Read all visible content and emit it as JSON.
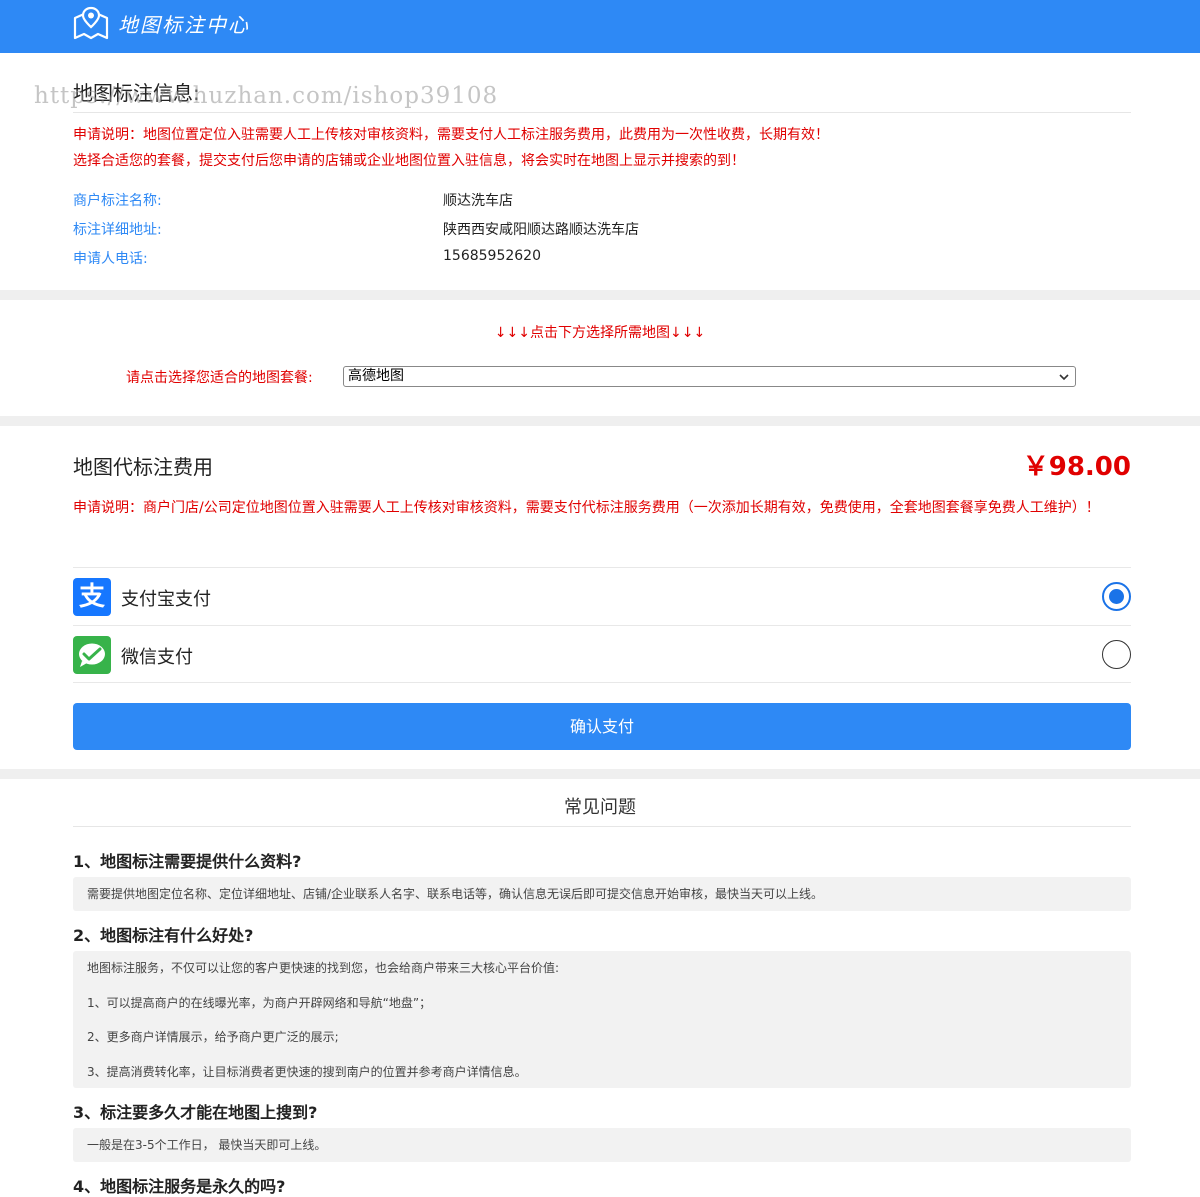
{
  "header": {
    "logo_text": "地图标注中心"
  },
  "info": {
    "title": "地图标注信息:",
    "watermark": "https://www.huzhan.com/ishop39108",
    "note_line1": "申请说明：地图位置定位入驻需要人工上传核对审核资料，需要支付人工标注服务费用，此费用为一次性收费，长期有效！",
    "note_line2": "选择合适您的套餐，提交支付后您申请的店铺或企业地图位置入驻信息，将会实时在地图上显示并搜索的到！",
    "rows": [
      {
        "label": "商户标注名称:",
        "value": "顺达洗车店"
      },
      {
        "label": "标注详细地址:",
        "value": "陕西西安咸阳顺达路顺达洗车店"
      },
      {
        "label": "申请人电话:",
        "value": "15685952620"
      }
    ]
  },
  "selector": {
    "tip": "↓↓↓点击下方选择所需地图↓↓↓",
    "label": "请点击选择您适合的地图套餐:",
    "selected": "高德地图"
  },
  "fee": {
    "title": "地图代标注费用",
    "price": "￥98.00",
    "note": "申请说明：商户门店/公司定位地图位置入驻需要人工上传核对审核资料，需要支付代标注服务费用（一次添加长期有效，免费使用，全套地图套餐享免费人工维护）！",
    "methods": [
      {
        "label": "支付宝支付",
        "icon": "alipay-icon",
        "checked": true
      },
      {
        "label": "微信支付",
        "icon": "wechat-icon",
        "checked": false
      }
    ],
    "alipay_glyph": "支",
    "confirm_label": "确认支付"
  },
  "faq": {
    "title": "常见问题",
    "items": [
      {
        "q": "1、地图标注需要提供什么资料?",
        "a": [
          "需要提供地图定位名称、定位详细地址、店铺/企业联系人名字、联系电话等，确认信息无误后即可提交信息开始审核，最快当天可以上线。"
        ]
      },
      {
        "q": "2、地图标注有什么好处?",
        "a": [
          "地图标注服务，不仅可以让您的客户更快速的找到您，也会给商户带来三大核心平台价值:",
          "1、可以提高商户的在线曝光率，为商户开辟网络和导航“地盘”；",
          "2、更多商户详情展示，给予商户更广泛的展示;",
          "3、提高消费转化率，让目标消费者更快速的搜到南户的位置并参考商户详情信息。"
        ]
      },
      {
        "q": "3、标注要多久才能在地图上搜到?",
        "a": [
          "一般是在3-5个工作日， 最快当天即可上线。"
        ]
      },
      {
        "q": "4、地图标注服务是永久的吗?",
        "a": []
      }
    ]
  }
}
